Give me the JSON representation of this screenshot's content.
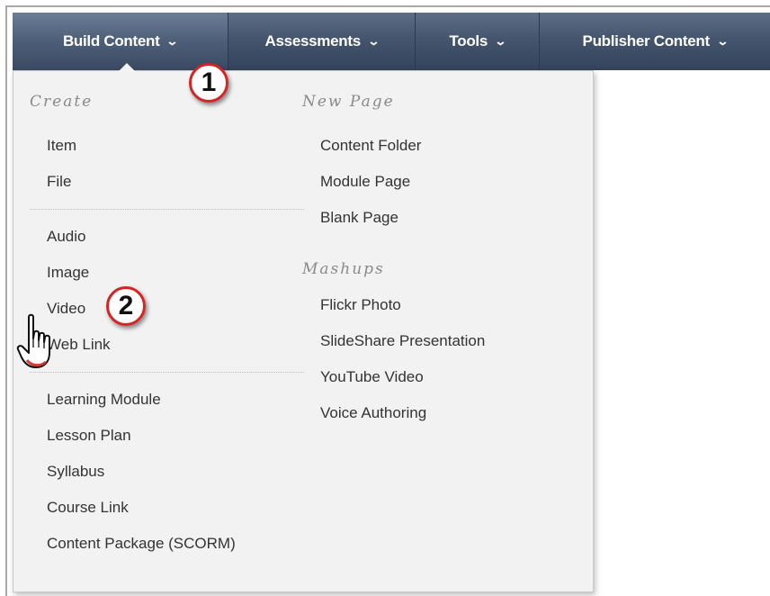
{
  "nav": {
    "items": [
      {
        "label": "Build Content",
        "chevron": "⌄"
      },
      {
        "label": "Assessments",
        "chevron": "⌄"
      },
      {
        "label": "Tools",
        "chevron": "⌄"
      },
      {
        "label": "Publisher Content",
        "chevron": "⌄"
      }
    ]
  },
  "dropdown": {
    "create": {
      "heading": "Create",
      "items": [
        "Item",
        "File",
        "Audio",
        "Image",
        "Video",
        "Web Link",
        "Learning Module",
        "Lesson Plan",
        "Syllabus",
        "Course Link",
        "Content Package (SCORM)"
      ]
    },
    "new_page": {
      "heading": "New Page",
      "items": [
        "Content Folder",
        "Module Page",
        "Blank Page"
      ]
    },
    "mashups": {
      "heading": "Mashups",
      "items": [
        "Flickr Photo",
        "SlideShare Presentation",
        "YouTube Video",
        "Voice Authoring"
      ]
    }
  },
  "callouts": {
    "one": "1",
    "two": "2"
  },
  "colors": {
    "nav_bg": "#45556e",
    "callout_border": "#d42424",
    "menu_bg": "#f2f2f2"
  },
  "icons": {
    "cursor": "hand-pointer-icon",
    "chevron": "chevron-down-icon"
  }
}
